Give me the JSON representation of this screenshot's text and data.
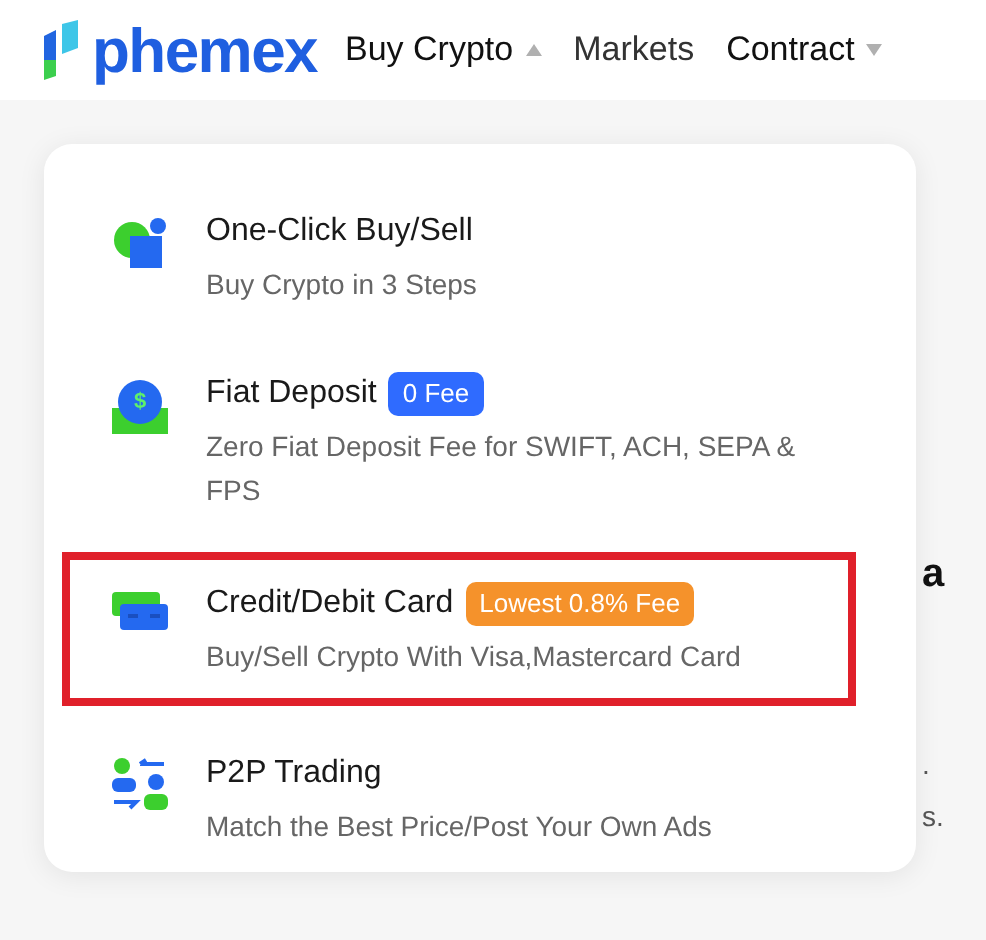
{
  "logo": {
    "text": "phemex"
  },
  "nav": [
    {
      "kind": "dropdown",
      "label": "Buy Crypto",
      "expanded": true
    },
    {
      "kind": "link",
      "label": "Markets"
    },
    {
      "kind": "dropdown",
      "label": "Contract",
      "expanded": false
    }
  ],
  "background_fragments": [
    "a",
    ".",
    "s."
  ],
  "menu": [
    {
      "kind": "oneclick",
      "title": "One-Click Buy/Sell",
      "subtitle": "Buy Crypto in 3 Steps",
      "highlighted": false
    },
    {
      "kind": "deposit",
      "icon_text": "$",
      "title": "Fiat Deposit",
      "badge": {
        "text": "0 Fee",
        "color": "#2f6bff"
      },
      "subtitle": "Zero Fiat Deposit Fee for SWIFT, ACH, SEPA & FPS",
      "highlighted": false
    },
    {
      "kind": "card",
      "title": "Credit/Debit Card",
      "badge": {
        "text": "Lowest 0.8% Fee",
        "color": "#f5922b"
      },
      "subtitle": "Buy/Sell Crypto With Visa,Mastercard Card",
      "highlighted": true
    },
    {
      "kind": "p2p",
      "title": "P2P Trading",
      "subtitle": "Match the Best Price/Post Your Own Ads",
      "highlighted": false
    }
  ]
}
